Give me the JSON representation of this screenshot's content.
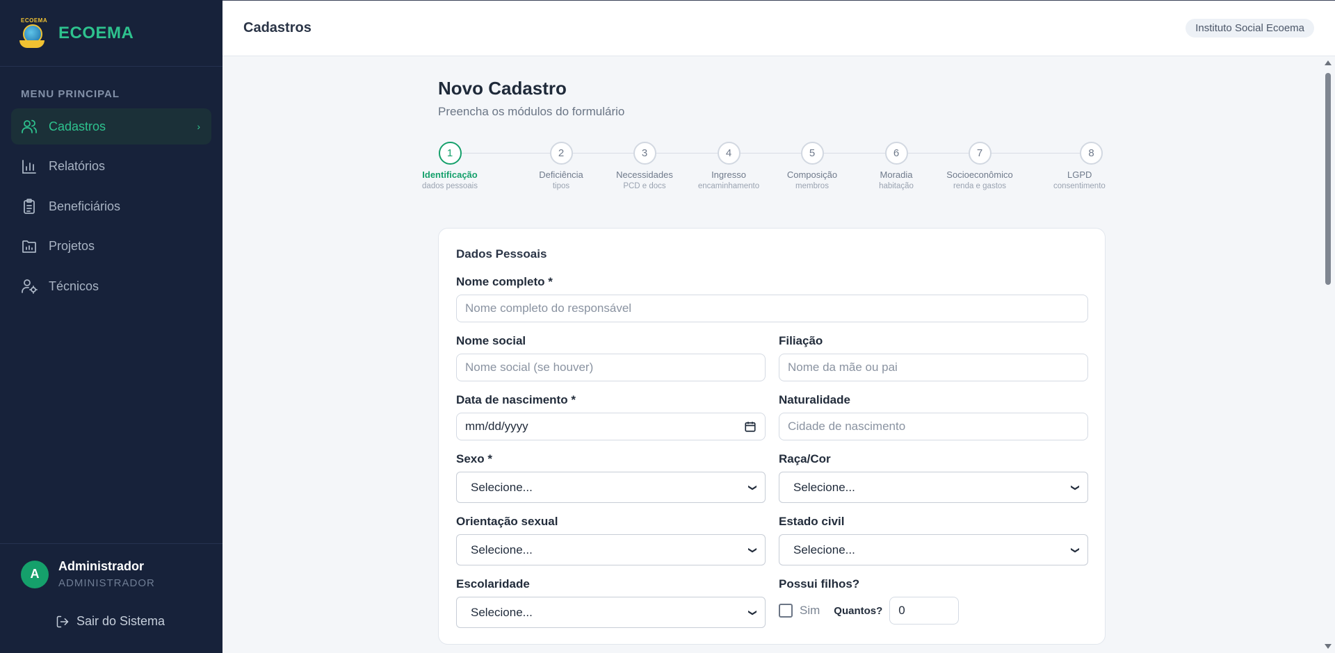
{
  "brand": {
    "name": "ECOEMA",
    "logo_text": "ECOEMA"
  },
  "sidebar": {
    "menu_title": "MENU PRINCIPAL",
    "items": [
      {
        "label": "Cadastros",
        "icon": "users-icon",
        "active": true
      },
      {
        "label": "Relatórios",
        "icon": "bar-chart-icon",
        "active": false
      },
      {
        "label": "Beneficiários",
        "icon": "clipboard-icon",
        "active": false
      },
      {
        "label": "Projetos",
        "icon": "folder-chart-icon",
        "active": false
      },
      {
        "label": "Técnicos",
        "icon": "user-gear-icon",
        "active": false
      }
    ],
    "user": {
      "initial": "A",
      "name": "Administrador",
      "role": "ADMINISTRADOR"
    },
    "logout_label": "Sair do Sistema"
  },
  "header": {
    "title": "Cadastros",
    "org": "Instituto Social Ecoema"
  },
  "page": {
    "title": "Novo Cadastro",
    "subtitle": "Preencha os módulos do formulário"
  },
  "steps": [
    {
      "number": "1",
      "label": "Identificação",
      "sub": "dados pessoais",
      "active": true
    },
    {
      "number": "2",
      "label": "Deficiência",
      "sub": "tipos",
      "active": false
    },
    {
      "number": "3",
      "label": "Necessidades",
      "sub": "PCD e docs",
      "active": false
    },
    {
      "number": "4",
      "label": "Ingresso",
      "sub": "encaminhamento",
      "active": false
    },
    {
      "number": "5",
      "label": "Composição",
      "sub": "membros",
      "active": false
    },
    {
      "number": "6",
      "label": "Moradia",
      "sub": "habitação",
      "active": false
    },
    {
      "number": "7",
      "label": "Socioeconômico",
      "sub": "renda e gastos",
      "active": false
    },
    {
      "number": "8",
      "label": "LGPD",
      "sub": "consentimento",
      "active": false
    }
  ],
  "form": {
    "section_title": "Dados Pessoais",
    "nome_completo": {
      "label": "Nome completo *",
      "placeholder": "Nome completo do responsável"
    },
    "nome_social": {
      "label": "Nome social",
      "placeholder": "Nome social (se houver)"
    },
    "filiacao": {
      "label": "Filiação",
      "placeholder": "Nome da mãe ou pai"
    },
    "data_nascimento": {
      "label": "Data de nascimento *",
      "placeholder": "mm/dd/yyyy"
    },
    "naturalidade": {
      "label": "Naturalidade",
      "placeholder": "Cidade de nascimento"
    },
    "sexo": {
      "label": "Sexo *",
      "value": "Selecione..."
    },
    "raca_cor": {
      "label": "Raça/Cor",
      "value": "Selecione..."
    },
    "orientacao": {
      "label": "Orientação sexual",
      "value": "Selecione..."
    },
    "estado_civil": {
      "label": "Estado civil",
      "value": "Selecione..."
    },
    "escolaridade": {
      "label": "Escolaridade",
      "value": "Selecione..."
    },
    "possui_filhos": {
      "label": "Possui filhos?",
      "checkbox_label": "Sim",
      "checked": false,
      "qty_label": "Quantos?",
      "qty_value": "0"
    }
  }
}
